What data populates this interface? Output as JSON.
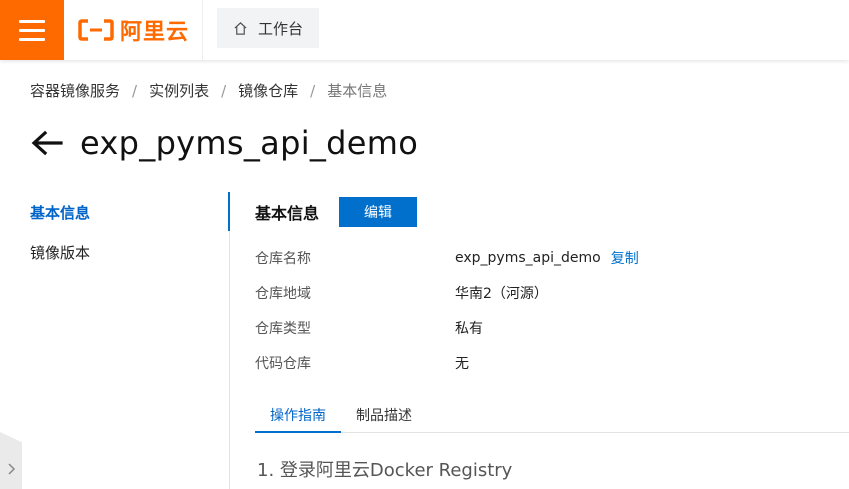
{
  "header": {
    "logo_text": "阿里云",
    "workbench_label": "工作台"
  },
  "breadcrumb": [
    "容器镜像服务",
    "实例列表",
    "镜像仓库",
    "基本信息"
  ],
  "page": {
    "title": "exp_pyms_api_demo"
  },
  "side_nav": {
    "items": [
      {
        "label": "基本信息",
        "active": true
      },
      {
        "label": "镜像版本",
        "active": false
      }
    ]
  },
  "basic_info": {
    "section_title": "基本信息",
    "edit_label": "编辑",
    "rows": [
      {
        "label": "仓库名称",
        "value": "exp_pyms_api_demo",
        "action": "复制"
      },
      {
        "label": "仓库地域",
        "value": "华南2（河源）"
      },
      {
        "label": "仓库类型",
        "value": "私有"
      },
      {
        "label": "代码仓库",
        "value": "无"
      }
    ]
  },
  "tabs": [
    {
      "label": "操作指南",
      "active": true
    },
    {
      "label": "制品描述",
      "active": false
    }
  ],
  "guide": {
    "step1_heading": "1. 登录阿里云Docker Registry"
  },
  "colors": {
    "brand_orange": "#ff6a00",
    "primary_blue": "#0070cc"
  }
}
